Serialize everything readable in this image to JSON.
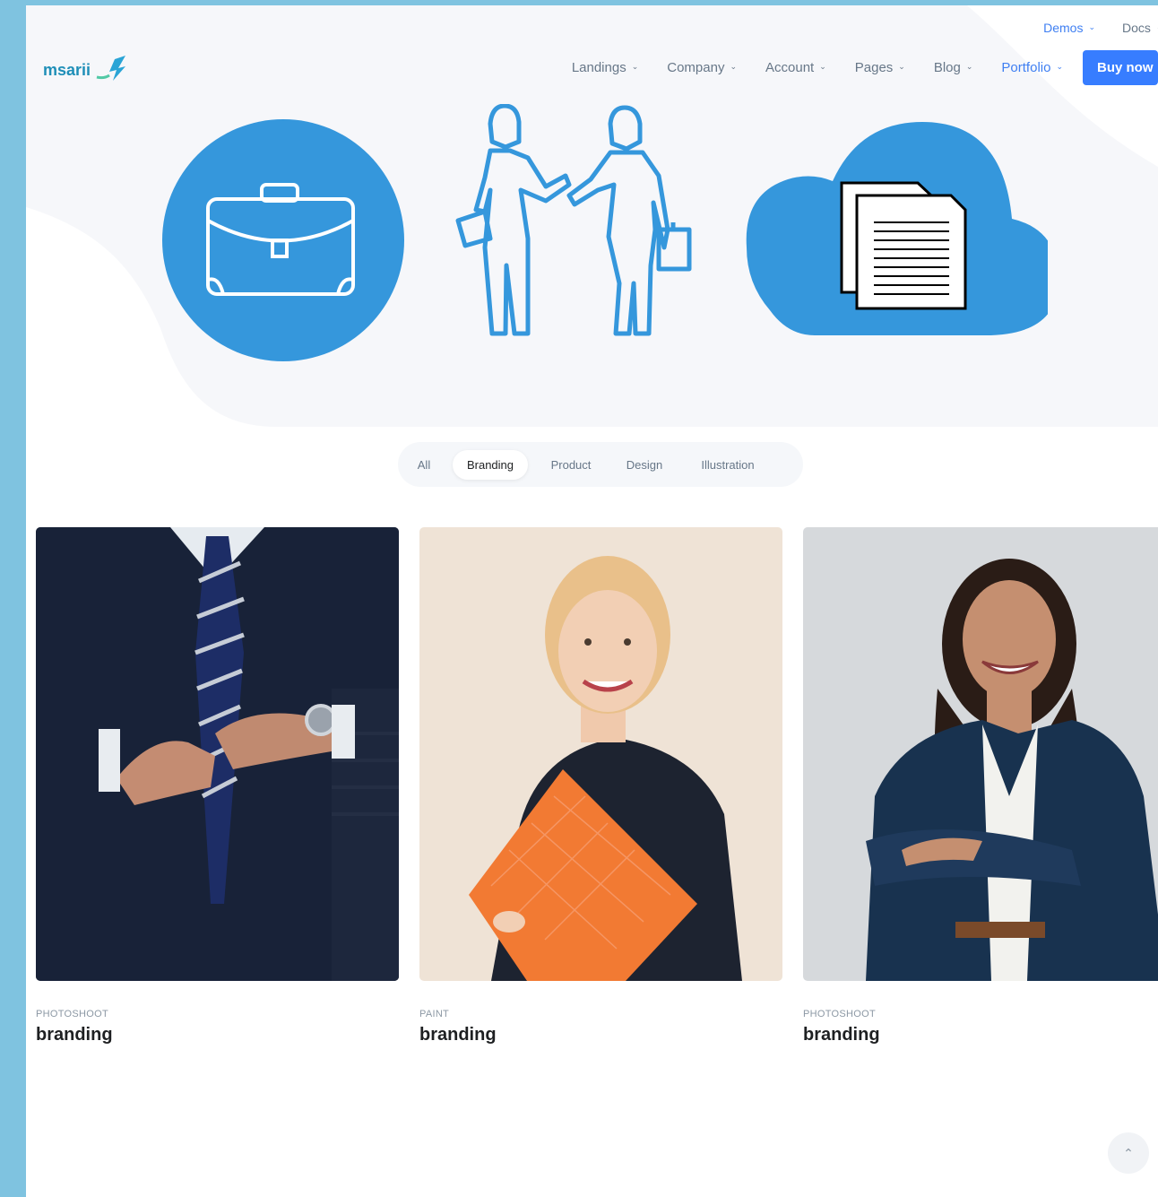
{
  "topbar": {
    "demos_label": "Demos",
    "docs_label": "Docs"
  },
  "logo": {
    "text": "msarii"
  },
  "nav": {
    "items": [
      "Landings",
      "Company",
      "Account",
      "Pages",
      "Blog",
      "Portfolio"
    ],
    "buy_label": "Buy now"
  },
  "filters": {
    "items": [
      "All",
      "Branding",
      "Product",
      "Design",
      "Illustration"
    ],
    "active": "Branding"
  },
  "cards": [
    {
      "category": "PHOTOSHOOT",
      "title": "branding"
    },
    {
      "category": "PAINT",
      "title": "branding"
    },
    {
      "category": "PHOTOSHOOT",
      "title": "branding"
    }
  ],
  "colors": {
    "accent": "#377dff",
    "illustration_blue": "#3597dc",
    "frame": "#7fc3e0"
  },
  "icons": [
    "briefcase-icon",
    "people-icon",
    "cloud-documents-icon",
    "chevron-up-icon"
  ]
}
